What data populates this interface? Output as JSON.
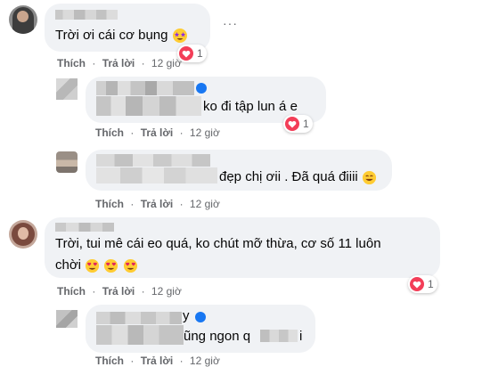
{
  "colors": {
    "bubble": "#f0f2f5",
    "heart": "#f33e58",
    "verified": "#1877f2",
    "meta": "#65676b"
  },
  "comments": [
    {
      "text": "Trời ơi cái cơ bụng",
      "like": "Thích",
      "reply": "Trả lời",
      "time": "12 giờ",
      "reaction_count": "1",
      "more": "···"
    },
    {
      "text": "ko đi tập lun á e",
      "like": "Thích",
      "reply": "Trả lời",
      "time": "12 giờ",
      "reaction_count": "1"
    },
    {
      "text": "đẹp chị ơii . Đã quá điiii",
      "like": "Thích",
      "reply": "Trả lời",
      "time": "12 giờ"
    },
    {
      "text_line1": "Trời, tui mê cái eo quá, ko chút mỡ thừa, cơ số 11 luôn",
      "text_line2": "chời",
      "like": "Thích",
      "reply": "Trả lời",
      "time": "12 giờ",
      "reaction_count": "1"
    },
    {
      "text_name_fragment": "y",
      "text": "ũng ngon q",
      "text_end": "i",
      "like": "Thích",
      "reply": "Trả lời",
      "time": "12 giờ"
    }
  ]
}
